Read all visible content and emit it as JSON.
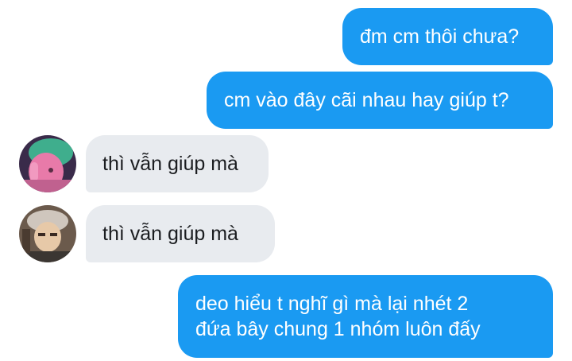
{
  "conversation": {
    "messages": [
      {
        "sender": "me",
        "text": "đm cm thôi chưa?"
      },
      {
        "sender": "me",
        "text": "cm vào đây cãi nhau hay giúp t?"
      },
      {
        "sender": "other",
        "avatar": "avatar-green-hair",
        "text": "thì vẫn giúp mà"
      },
      {
        "sender": "other",
        "avatar": "avatar-beanie",
        "text": "thì vẫn giúp mà"
      },
      {
        "sender": "me",
        "text": "deo hiểu t nghĩ gì mà lại nhét 2\nđứa bây chung 1 nhóm luôn đấy"
      }
    ]
  },
  "colors": {
    "outgoing_bubble": "#1a9af2",
    "incoming_bubble": "#e8ebef",
    "outgoing_text": "#ffffff",
    "incoming_text": "#1b1d20"
  }
}
